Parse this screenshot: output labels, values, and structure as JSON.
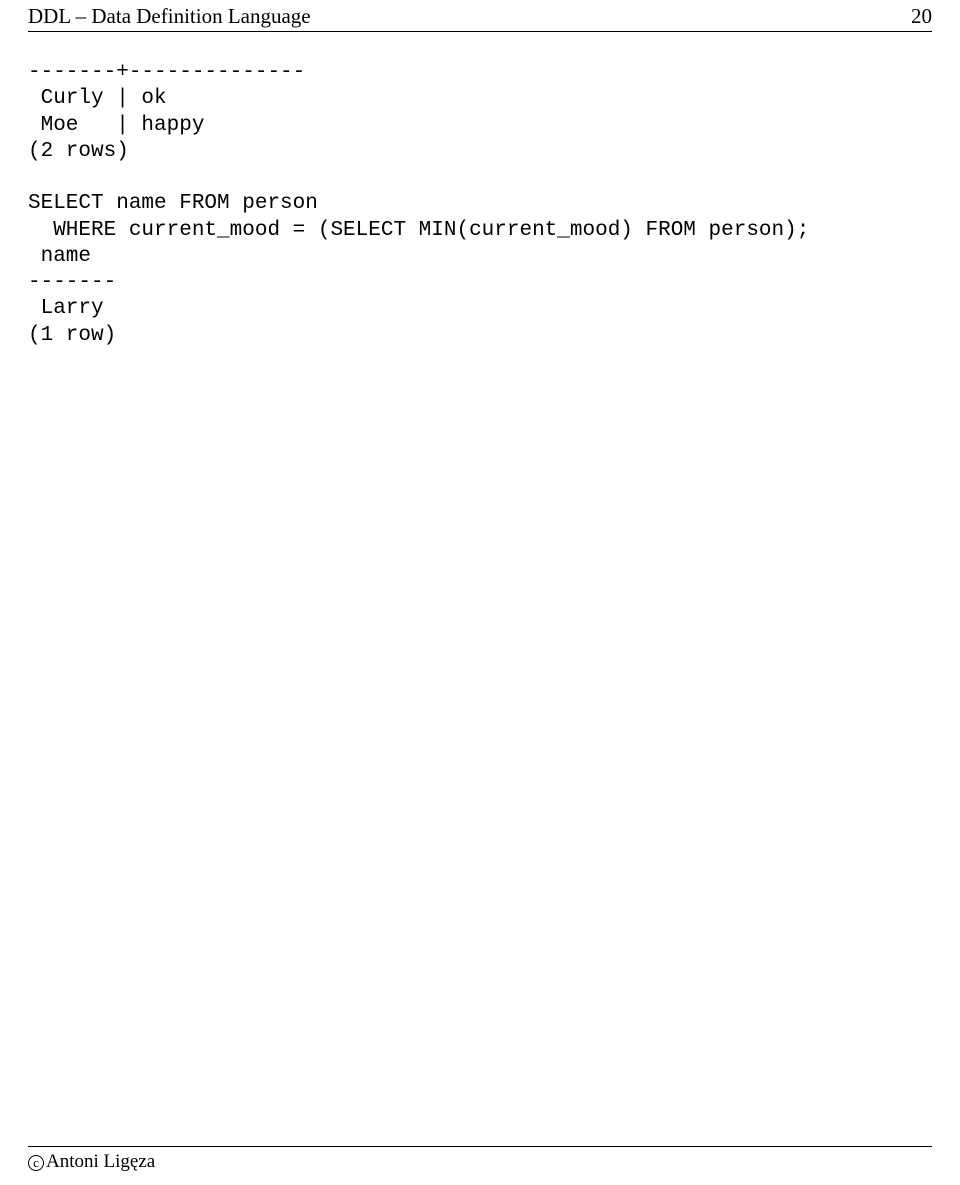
{
  "header": {
    "title": "DDL – Data Definition Language",
    "page_number": "20"
  },
  "code": {
    "line1": "-------+--------------",
    "line2": " Curly | ok",
    "line3": " Moe   | happy",
    "line4": "(2 rows)",
    "line5": "",
    "line6": "SELECT name FROM person",
    "line7": "  WHERE current_mood = (SELECT MIN(current_mood) FROM person);",
    "line8": " name",
    "line9": "-------",
    "line10": " Larry",
    "line11": "(1 row)"
  },
  "footer": {
    "copyright": "c",
    "author": "Antoni Ligęza"
  }
}
